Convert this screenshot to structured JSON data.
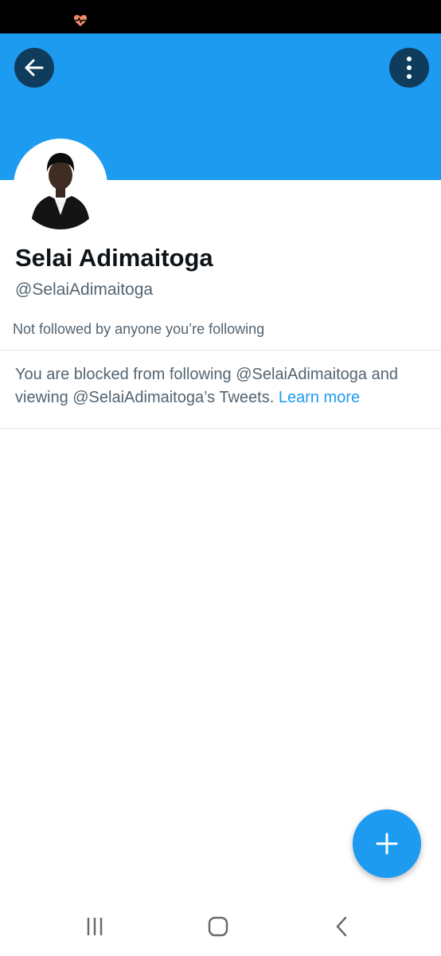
{
  "status_bar": {
    "icon": "heart-pulse-icon",
    "icon_color": "#f08a6a"
  },
  "header": {
    "banner_color": "#1d9bf0",
    "back_icon": "arrow-left-icon",
    "more_icon": "more-vertical-icon"
  },
  "profile": {
    "display_name": "Selai Adimaitoga",
    "handle": "@SelaiAdimaitoga",
    "followed_by": "Not followed by anyone you’re following"
  },
  "blocked_notice": {
    "text": "You are blocked from following @SelaiAdimaitoga and viewing @SelaiAdimaitoga’s Tweets. ",
    "link": "Learn more",
    "link_color": "#1d9bf0"
  },
  "fab": {
    "icon": "plus-icon"
  },
  "nav_bar": {
    "recents_icon": "recents-icon",
    "home_icon": "home-icon",
    "back_icon": "back-chevron-icon"
  }
}
